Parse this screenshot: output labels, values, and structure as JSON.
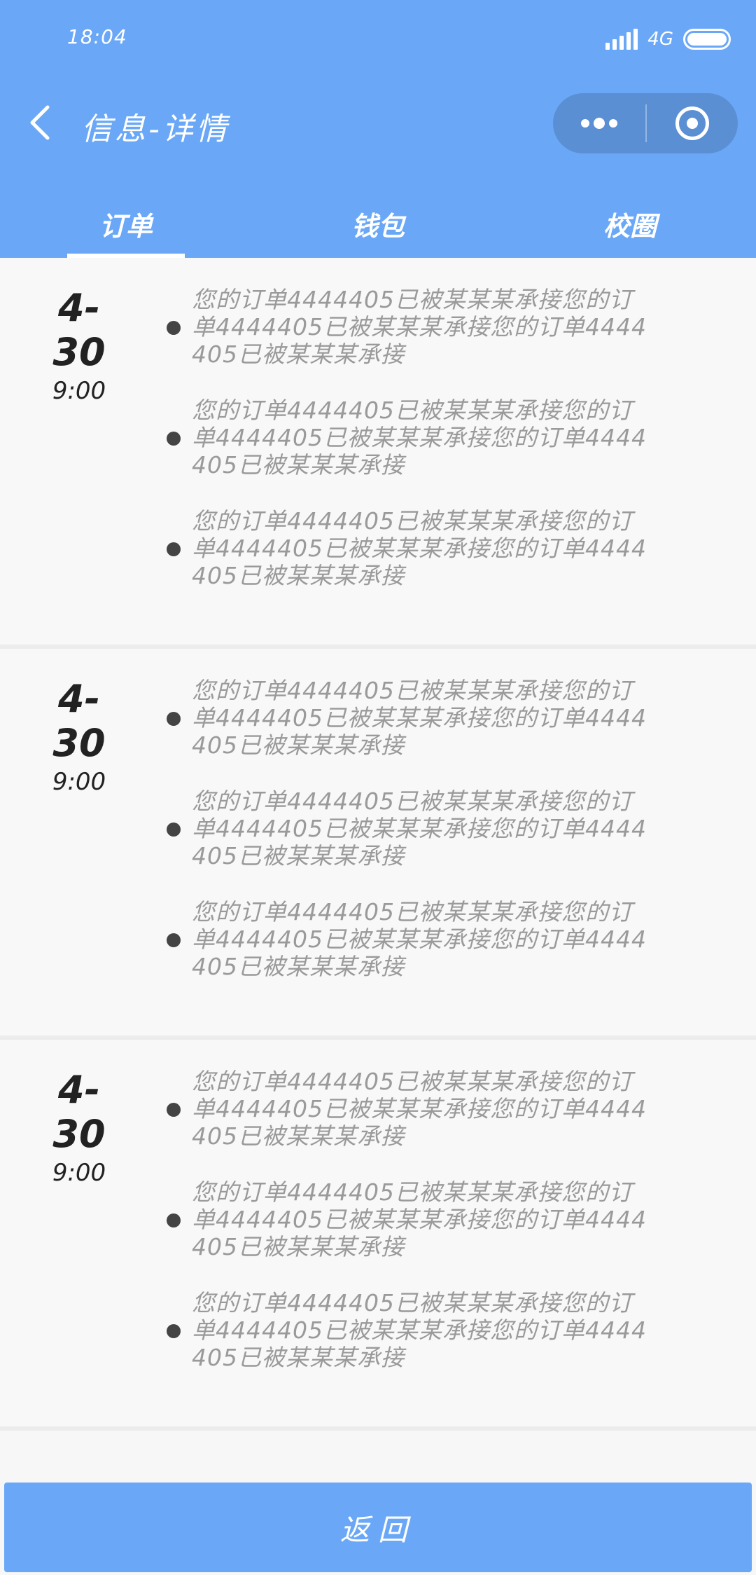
{
  "status_bar": {
    "time": "18:04",
    "network": "4G"
  },
  "header": {
    "title": "信息-详情",
    "bg_color": "#6aa8f7"
  },
  "tabs": [
    {
      "label": "订单"
    },
    {
      "label": "钱包"
    },
    {
      "label": "校圈"
    }
  ],
  "groups": [
    {
      "date": "4-30",
      "time": "9:00",
      "messages": [
        "您的订单4444405已被某某某承接您的订单4444405已被某某某承接您的订单4444405已被某某某承接",
        "您的订单4444405已被某某某承接您的订单4444405已被某某某承接您的订单4444405已被某某某承接",
        "您的订单4444405已被某某某承接您的订单4444405已被某某某承接您的订单4444405已被某某某承接"
      ]
    },
    {
      "date": "4-30",
      "time": "9:00",
      "messages": [
        "您的订单4444405已被某某某承接您的订单4444405已被某某某承接您的订单4444405已被某某某承接",
        "您的订单4444405已被某某某承接您的订单4444405已被某某某承接您的订单4444405已被某某某承接",
        "您的订单4444405已被某某某承接您的订单4444405已被某某某承接您的订单4444405已被某某某承接"
      ]
    },
    {
      "date": "4-30",
      "time": "9:00",
      "messages": [
        "您的订单4444405已被某某某承接您的订单4444405已被某某某承接您的订单4444405已被某某某承接",
        "您的订单4444405已被某某某承接您的订单4444405已被某某某承接您的订单4444405已被某某某承接",
        "您的订单4444405已被某某某承接您的订单4444405已被某某某承接您的订单4444405已被某某某承接"
      ]
    }
  ],
  "footer": {
    "back_label": "返回"
  }
}
